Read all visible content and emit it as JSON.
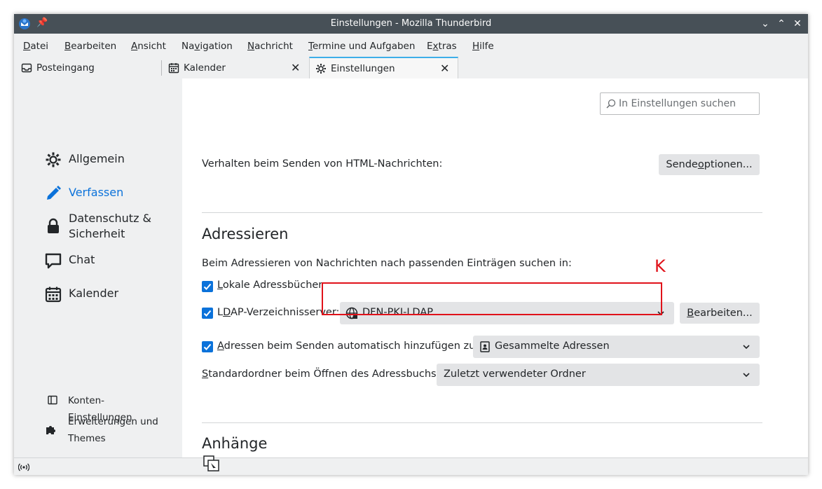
{
  "window": {
    "title": "Einstellungen - Mozilla Thunderbird"
  },
  "menu": [
    {
      "pre": "",
      "u": "D",
      "post": "atei"
    },
    {
      "pre": "",
      "u": "B",
      "post": "earbeiten"
    },
    {
      "pre": "",
      "u": "A",
      "post": "nsicht"
    },
    {
      "pre": "Na",
      "u": "v",
      "post": "igation"
    },
    {
      "pre": "",
      "u": "N",
      "post": "achricht"
    },
    {
      "pre": "",
      "u": "T",
      "post": "ermine und Aufgaben"
    },
    {
      "pre": "E",
      "u": "x",
      "post": "tras"
    },
    {
      "pre": "",
      "u": "H",
      "post": "ilfe"
    }
  ],
  "tabs": {
    "inbox": "Posteingang",
    "calendar": "Kalender",
    "settings": "Einstellungen"
  },
  "sidebar": {
    "general": "Allgemein",
    "compose": "Verfassen",
    "privacy": "Datenschutz & Sicherheit",
    "chat": "Chat",
    "calendar": "Kalender",
    "accounts": "Konten-Einstellungen",
    "addons": "Erweiterungen und Themes"
  },
  "search": {
    "placeholder": "In Einstellungen suchen"
  },
  "compose": {
    "html_label": "Verhalten beim Senden von HTML-Nachrichten:",
    "send_options_pre": "Sende",
    "send_options_u": "o",
    "send_options_post": "ptionen..."
  },
  "addressing": {
    "heading": "Adressieren",
    "intro": "Beim Adressieren von Nachrichten nach passenden Einträgen suchen in:",
    "local_u": "L",
    "local_post": "okale Adressbücher",
    "ldap_pre": "L",
    "ldap_u": "D",
    "ldap_post": "AP-Verzeichnisserver:",
    "ldap_value": "DFN-PKI-LDAP",
    "edit_u": "B",
    "edit_post": "earbeiten...",
    "auto_u": "A",
    "auto_post": "dressen beim Senden automatisch hinzufügen zu:",
    "auto_value": "Gesammelte Adressen",
    "default_u": "S",
    "default_post": "tandardordner beim Öffnen des Adressbuchs:",
    "default_value": "Zuletzt verwendeter Ordner"
  },
  "attachments": {
    "heading": "Anhänge"
  },
  "annotation": {
    "label": "K",
    "color": "#e0121a"
  },
  "colors": {
    "accent": "#0b72da",
    "titlebar": "#475057"
  }
}
